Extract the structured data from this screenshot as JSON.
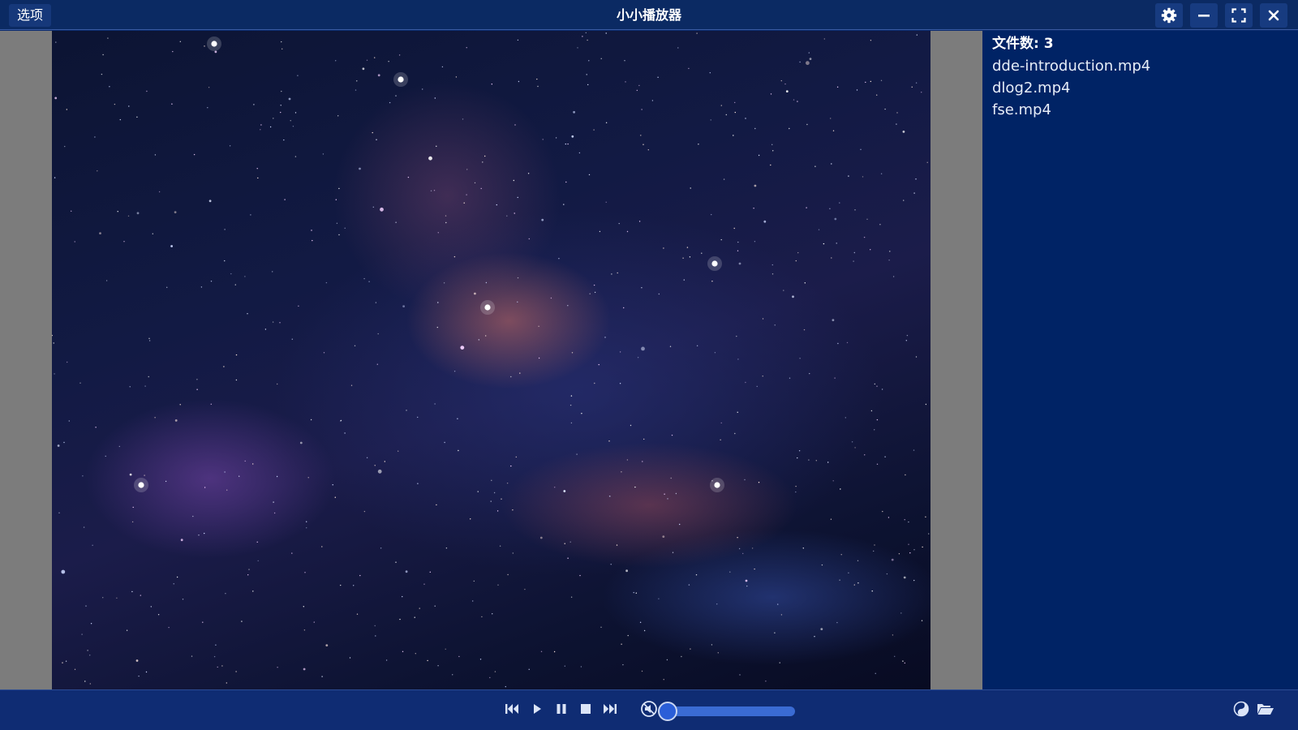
{
  "window": {
    "title": "小小播放器",
    "menu_label": "选项",
    "buttons": [
      "gear-icon",
      "minimize-icon",
      "fullscreen-icon",
      "close-icon"
    ]
  },
  "playlist": {
    "count_label": "文件数: 3",
    "files": [
      "dde-introduction.mp4",
      "dlog2.mp4",
      "fse.mp4"
    ]
  },
  "controls": {
    "buttons": [
      "skip-previous-icon",
      "play-icon",
      "pause-icon",
      "stop-icon",
      "skip-next-icon",
      "mute-icon"
    ],
    "volume_fraction": 0.0,
    "right_icons": [
      "yin-yang-icon",
      "open-folder-icon"
    ]
  },
  "colors": {
    "titlebar": "#0b2a63",
    "playlist_bg": "#002365",
    "controls_bg": "#0f2c73",
    "accent": "#3a6bd3"
  }
}
